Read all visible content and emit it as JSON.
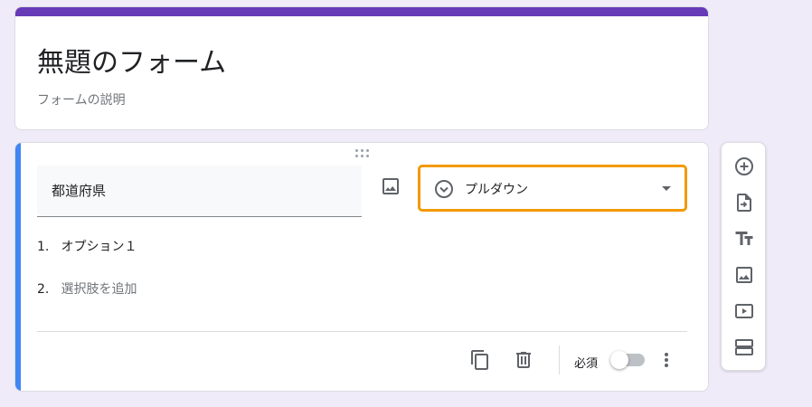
{
  "form": {
    "title": "無題のフォーム",
    "description": "フォームの説明",
    "accent_color": "#673ab7"
  },
  "question": {
    "title": "都道府県",
    "type_label": "プルダウン",
    "type_icon": "dropdown-circle-icon",
    "highlight_color": "#f29900",
    "options": [
      {
        "number": "1.",
        "label": "オプション１"
      },
      {
        "number": "2.",
        "label": "選択肢を追加"
      }
    ],
    "required_label": "必須",
    "required": false
  },
  "toolbar": {
    "items": [
      "add-question-icon",
      "import-questions-icon",
      "add-title-icon",
      "add-image-icon",
      "add-video-icon",
      "add-section-icon"
    ]
  }
}
